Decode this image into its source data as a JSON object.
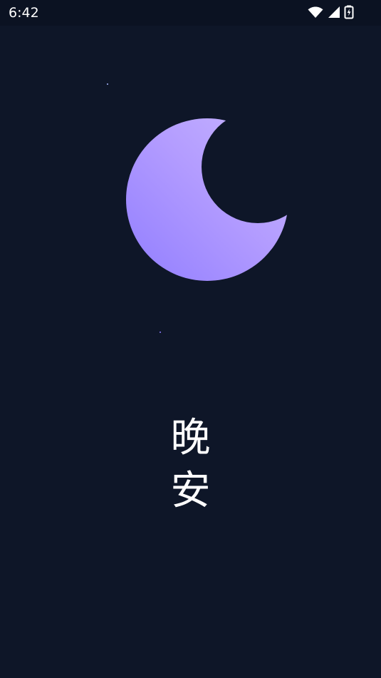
{
  "status_bar": {
    "time": "6:42",
    "icons": [
      "wifi-icon",
      "cellular-signal-icon",
      "battery-charging-icon"
    ],
    "background": "#0b1222"
  },
  "screen": {
    "background": "#0e1628",
    "moon_colors": {
      "start": "#8f7cff",
      "mid": "#b39cff",
      "end": "#c8b7ff"
    }
  },
  "greeting": {
    "line1": "晚",
    "line2": "安"
  }
}
